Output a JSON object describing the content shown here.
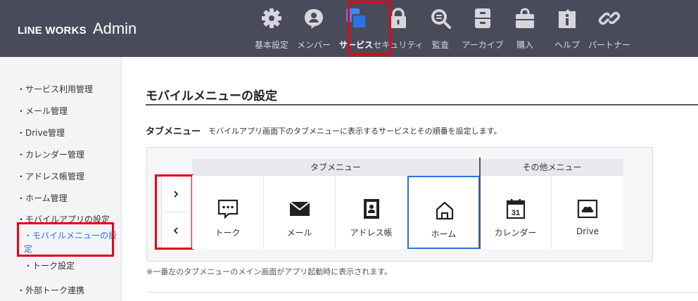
{
  "header": {
    "brand": "LINE WORKS",
    "admin": "Admin",
    "nav": [
      {
        "label": "基本設定",
        "icon": "gear-icon"
      },
      {
        "label": "メンバー",
        "icon": "member-icon"
      },
      {
        "label": "サービス",
        "icon": "service-icon"
      },
      {
        "label": "セキュリティ",
        "icon": "lock-icon"
      },
      {
        "label": "監査",
        "icon": "magnifier-icon"
      },
      {
        "label": "アーカイブ",
        "icon": "archive-icon"
      },
      {
        "label": "購入",
        "icon": "shopping-bag-icon"
      },
      {
        "label": "ヘルプ",
        "icon": "help-icon"
      },
      {
        "label": "パートナー",
        "icon": "link-icon"
      }
    ],
    "active_nav": "サービス"
  },
  "sidebar": {
    "items": [
      "・サービス利用管理",
      "・メール管理",
      "・Drive管理",
      "・カレンダー管理",
      "・アドレス帳管理",
      "・ホーム管理",
      "・モバイルアプリの設定",
      "・モバイルメニューの設",
      "定",
      "・トーク設定",
      "・外部トーク連携"
    ]
  },
  "main": {
    "page_title": "モバイルメニューの設定",
    "section_title": "タブメニュー",
    "section_desc": "モバイルアプリ画面下のタブメニューに表示するサービスとその順番を設定します。",
    "group_tab": "タブメニュー",
    "group_other": "その他メニュー",
    "tiles": [
      {
        "label": "トーク",
        "icon": "talk-icon"
      },
      {
        "label": "メール",
        "icon": "mail-icon"
      },
      {
        "label": "アドレス帳",
        "icon": "address-book-icon"
      },
      {
        "label": "ホーム",
        "icon": "home-icon"
      },
      {
        "label": "カレンダー",
        "icon": "calendar-icon"
      },
      {
        "label": "Drive",
        "icon": "drive-icon"
      }
    ],
    "calendar_day": "31",
    "footnote": "※一番左のタブメニューのメイン画面がアプリ起動時に表示されます。"
  },
  "colors": {
    "header_bg": "#4a4b5a",
    "accent_blue": "#2b73e0",
    "highlight_red": "#e60012"
  }
}
